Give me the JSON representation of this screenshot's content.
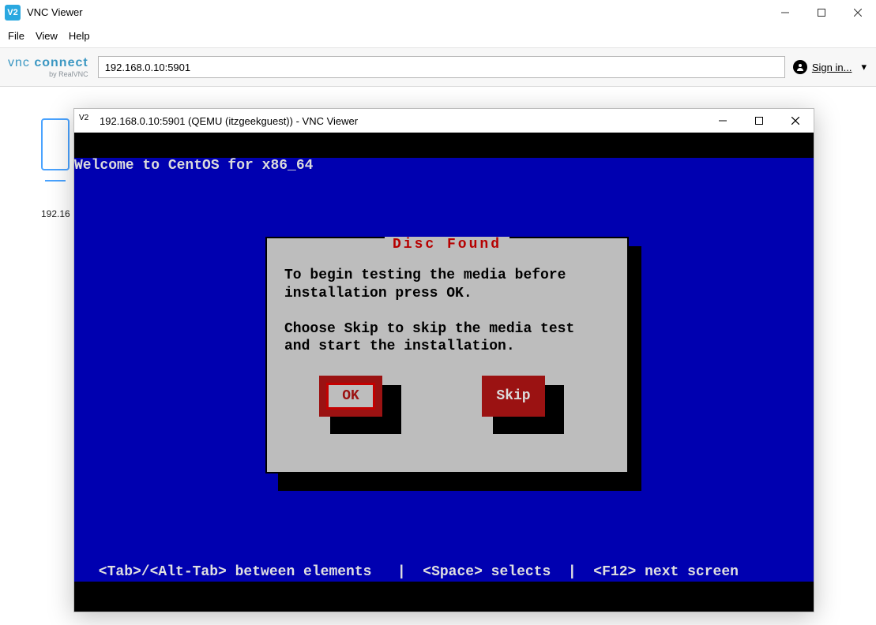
{
  "app": {
    "title": "VNC Viewer"
  },
  "menu": {
    "file": "File",
    "view": "View",
    "help": "Help"
  },
  "brand": {
    "line1_a": "vnc ",
    "line1_b": "connect",
    "line2": "by RealVNC"
  },
  "address": {
    "value": "192.168.0.10:5901"
  },
  "signin": {
    "label": "Sign in...",
    "chevron": "▾"
  },
  "thumbnail": {
    "label": "192.16"
  },
  "session": {
    "title": "192.168.0.10:5901 (QEMU (itzgeekguest)) - VNC Viewer"
  },
  "tui": {
    "welcome": "Welcome to CentOS for x86_64",
    "dialog_title": "Disc Found",
    "body_line1": "To begin testing the media before",
    "body_line2": "installation press OK.",
    "body_line3": "Choose Skip to skip the media test",
    "body_line4": "and start the installation.",
    "btn_ok": "OK",
    "btn_skip": "Skip",
    "footer": " <Tab>/<Alt-Tab> between elements   |  <Space> selects  |  <F12> next screen"
  }
}
